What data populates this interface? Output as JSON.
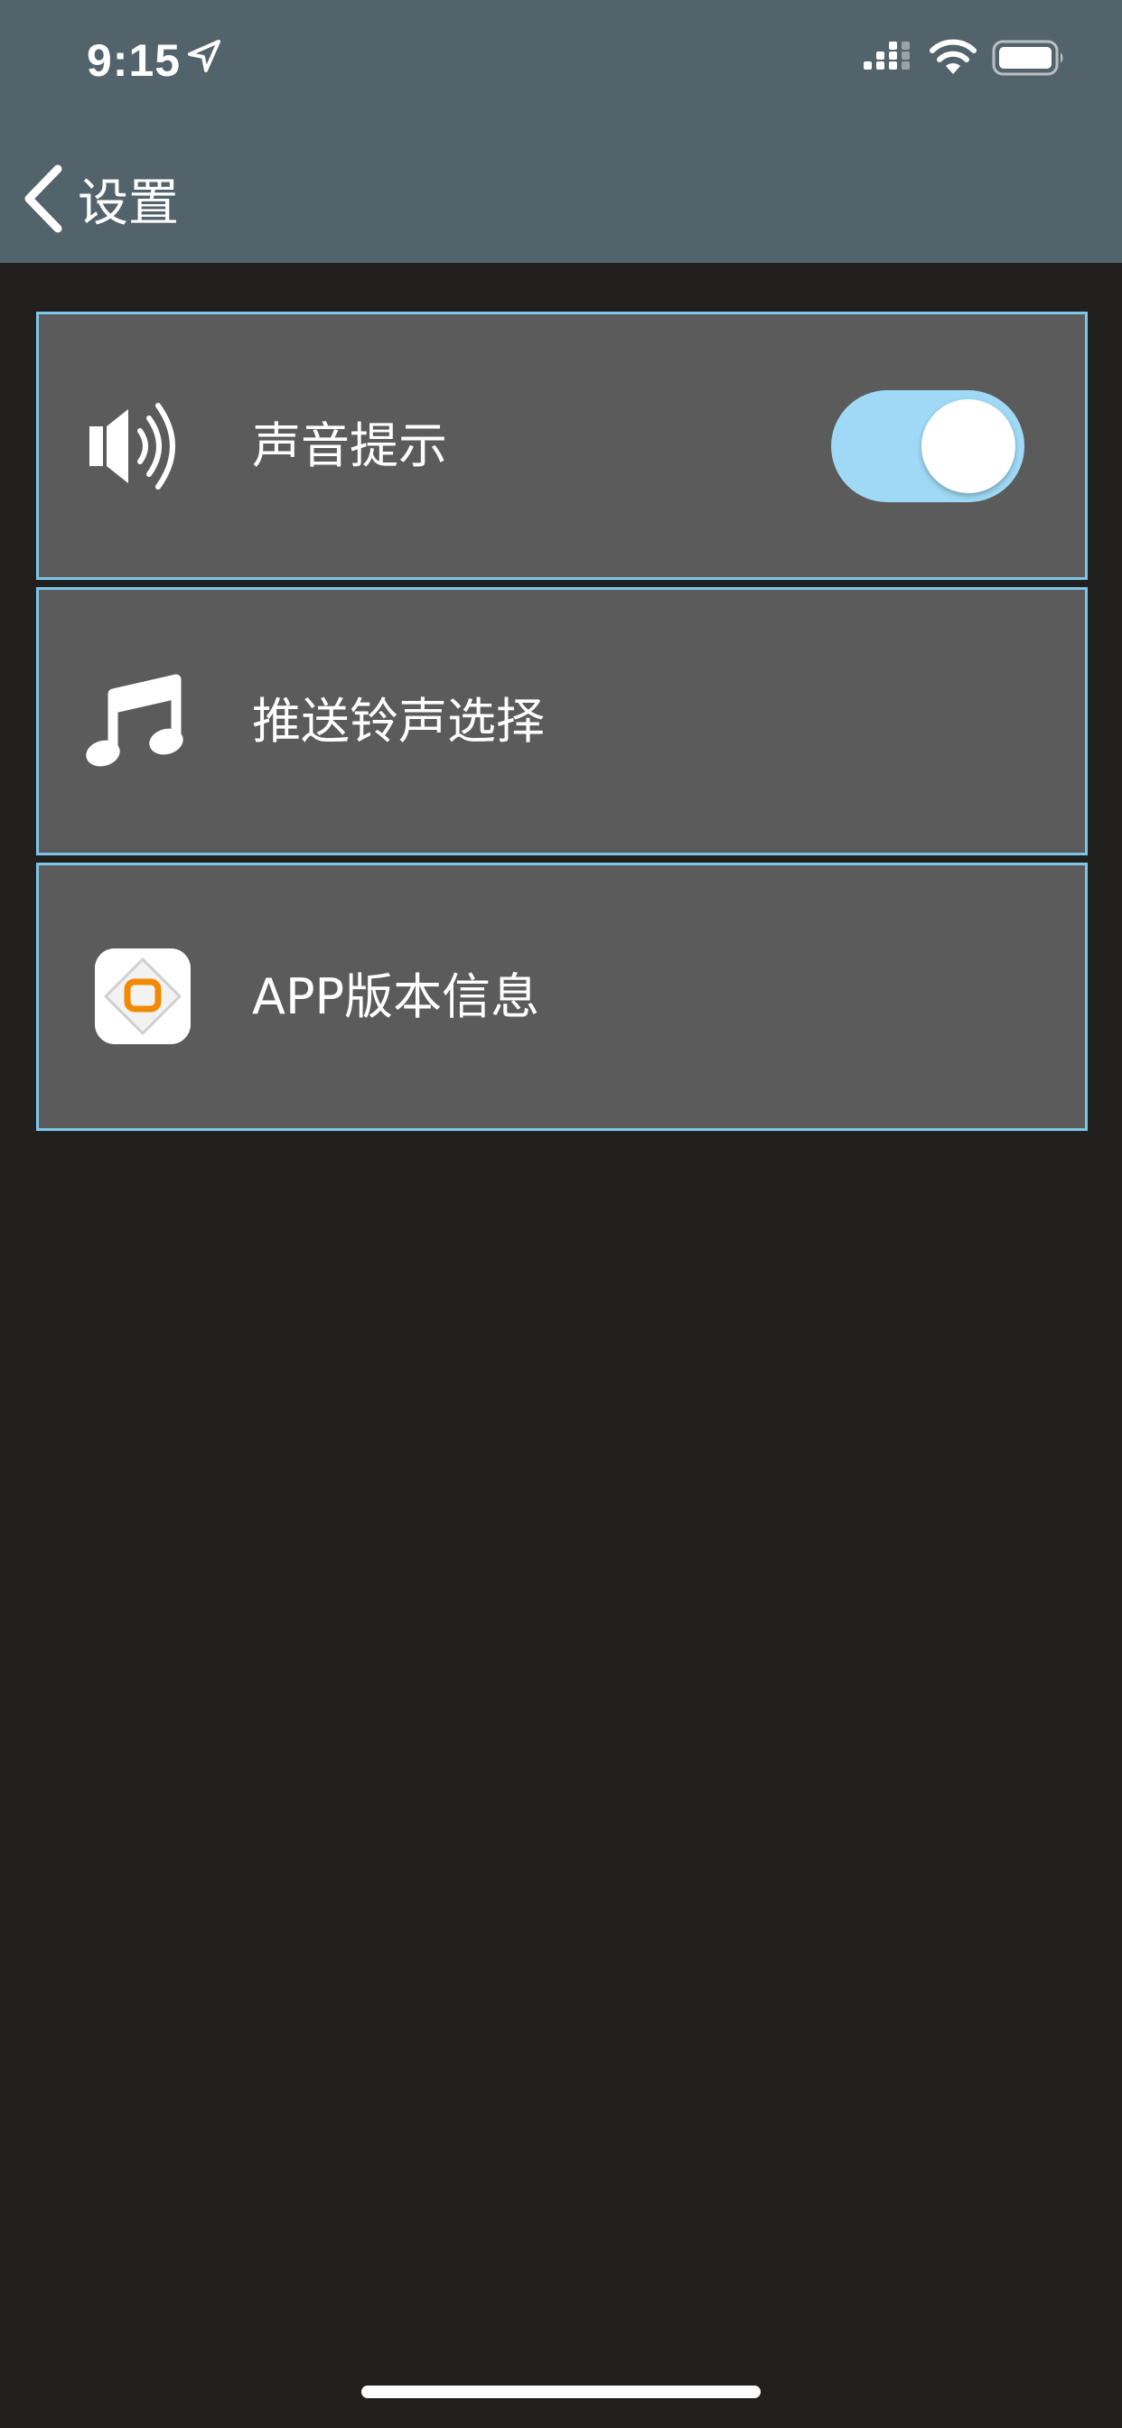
{
  "status_bar": {
    "time": "9:15"
  },
  "header": {
    "back_label": "设置"
  },
  "settings": [
    {
      "label": "声音提示",
      "icon": "speaker-icon",
      "toggle_on": true
    },
    {
      "label": "推送铃声选择",
      "icon": "music-note-icon"
    },
    {
      "label": "APP版本信息",
      "icon": "app-logo-icon"
    }
  ],
  "colors": {
    "header_bg": "#53636c",
    "page_bg": "#221f1f",
    "row_bg": "#5b5b5c",
    "row_border": "#7cc6ea",
    "toggle_on": "#9fd9f5",
    "logo_accent": "#f08a00"
  }
}
